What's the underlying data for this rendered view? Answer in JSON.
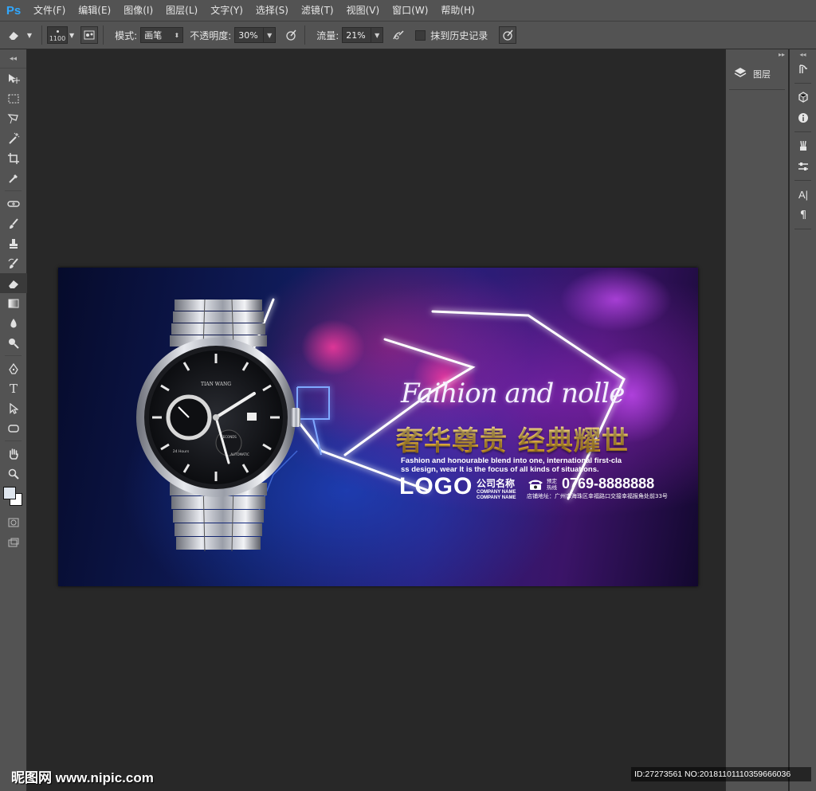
{
  "app": {
    "logo": "Ps",
    "menu": [
      "文件(F)",
      "编辑(E)",
      "图像(I)",
      "图层(L)",
      "文字(Y)",
      "选择(S)",
      "滤镜(T)",
      "视图(V)",
      "窗口(W)",
      "帮助(H)"
    ]
  },
  "options": {
    "brush_size": "1100",
    "mode_label": "模式:",
    "mode_value": "画笔",
    "opacity_label": "不透明度:",
    "opacity_value": "30%",
    "flow_label": "流量:",
    "flow_value": "21%",
    "history_label": "抹到历史记录"
  },
  "panels": {
    "layers_tab": "图层"
  },
  "document": {
    "script_line": "Faihion and nolle",
    "headline": "奢华尊贵 经典耀世",
    "english_line1": "Fashion and honourable blend into one, international first-cla",
    "english_line2": "ss design, wear It is the focus of all kinds of situations.",
    "logo": "LOGO",
    "company_cn": "公司名称",
    "company_en1": "COMPANY NAME",
    "company_en2": "COMPANY NAME",
    "phone_label1": "预定",
    "phone_label2": "热线",
    "phone": "0769-8888888",
    "address": "店铺地址：广州市海珠区幸福路口交接幸福报角处前33号",
    "watch_brand": "TIAN WANG",
    "watch_sub1": "24 Hours",
    "watch_sub2": "SECONDS",
    "watch_sub3": "AUTOMATIC"
  },
  "watermark": {
    "left": "昵图网 www.nipic.com",
    "right": "ID:27273561 NO:20181101110359666036"
  },
  "colors": {
    "chrome": "#535353",
    "canvas_bg": "#282828",
    "headline_gold": "#f5c24a",
    "ps_blue": "#31a8ff"
  }
}
